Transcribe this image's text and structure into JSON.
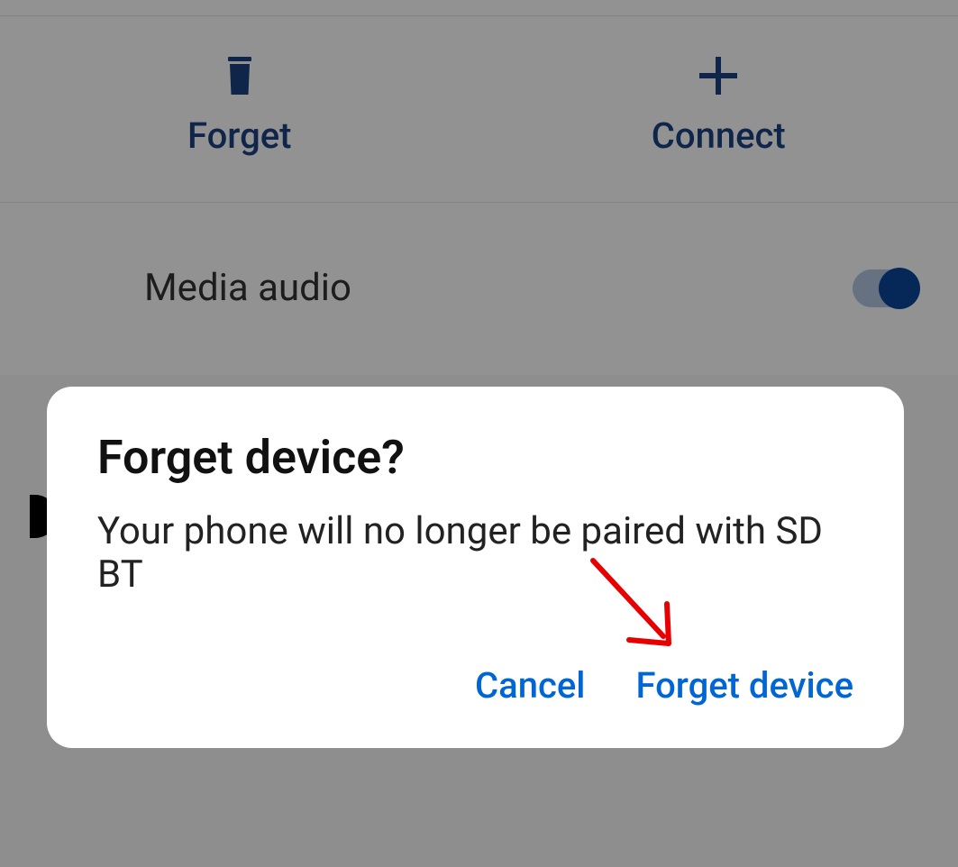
{
  "actions": {
    "forget_label": "Forget",
    "connect_label": "Connect"
  },
  "settings": {
    "media_audio_label": "Media audio",
    "media_audio_on": true
  },
  "dialog": {
    "title": "Forget device?",
    "message": "Your phone will no longer be paired with SD BT",
    "cancel_label": "Cancel",
    "confirm_label": "Forget device"
  },
  "colors": {
    "primary_blue": "#1a4080",
    "link_blue": "#0066d6",
    "toggle_on": "#0a4699",
    "annotation_red": "#e80000"
  }
}
